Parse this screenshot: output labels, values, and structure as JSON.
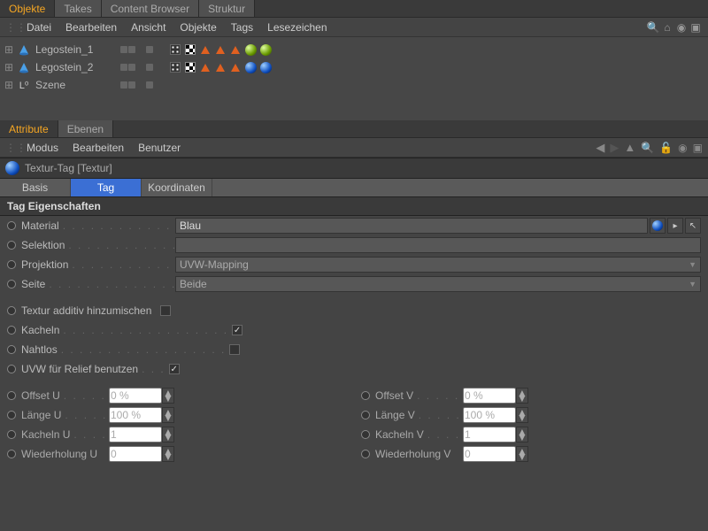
{
  "topTabs": {
    "objekte": "Objekte",
    "takes": "Takes",
    "contentBrowser": "Content Browser",
    "struktur": "Struktur"
  },
  "topMenu": {
    "datei": "Datei",
    "bearbeiten": "Bearbeiten",
    "ansicht": "Ansicht",
    "objekte": "Objekte",
    "tags": "Tags",
    "lesezeichen": "Lesezeichen"
  },
  "tree": {
    "items": [
      {
        "name": "Legostein_1",
        "tags_kind": "green"
      },
      {
        "name": "Legostein_2",
        "tags_kind": "blue"
      },
      {
        "name": "Szene"
      }
    ]
  },
  "attrTabs": {
    "attribute": "Attribute",
    "ebenen": "Ebenen"
  },
  "attrMenu": {
    "modus": "Modus",
    "bearbeiten": "Bearbeiten",
    "benutzer": "Benutzer"
  },
  "header": {
    "title": "Textur-Tag [Textur]"
  },
  "subTabs": {
    "basis": "Basis",
    "tag": "Tag",
    "koordinaten": "Koordinaten"
  },
  "section": "Tag Eigenschaften",
  "props": {
    "material": {
      "label": "Material",
      "value": "Blau"
    },
    "selektion": {
      "label": "Selektion",
      "value": ""
    },
    "projektion": {
      "label": "Projektion",
      "value": "UVW-Mapping"
    },
    "seite": {
      "label": "Seite",
      "value": "Beide"
    },
    "texturAdditiv": {
      "label": "Textur additiv hinzumischen",
      "checked": false
    },
    "kacheln": {
      "label": "Kacheln",
      "checked": true
    },
    "nahtlos": {
      "label": "Nahtlos",
      "checked": false
    },
    "uvwRelief": {
      "label": "UVW für Relief benutzen",
      "checked": true
    },
    "offsetU": {
      "label": "Offset U",
      "value": "0 %"
    },
    "offsetV": {
      "label": "Offset V",
      "value": "0 %"
    },
    "laengeU": {
      "label": "Länge U",
      "value": "100 %"
    },
    "laengeV": {
      "label": "Länge V",
      "value": "100 %"
    },
    "kachelnU": {
      "label": "Kacheln U",
      "value": "1"
    },
    "kachelnV": {
      "label": "Kacheln V",
      "value": "1"
    },
    "wiederholungU": {
      "label": "Wiederholung U",
      "value": "0"
    },
    "wiederholungV": {
      "label": "Wiederholung V",
      "value": "0"
    }
  }
}
